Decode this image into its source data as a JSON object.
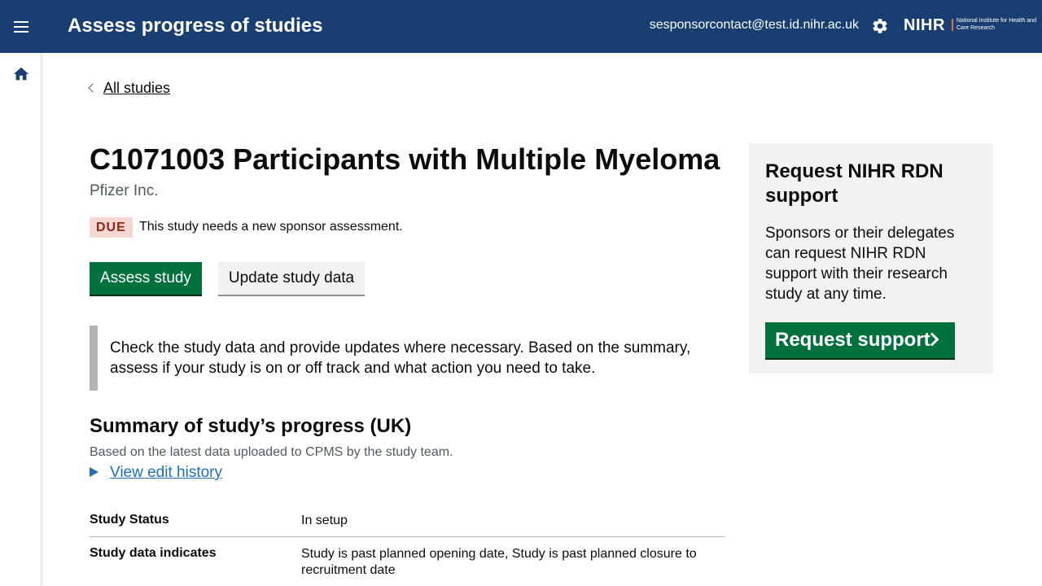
{
  "header": {
    "title": "Assess progress of studies",
    "user_email": "sesponsorcontact@test.id.nihr.ac.uk",
    "logo_main": "NIHR",
    "logo_sub": "National Institute for Health and Care Research",
    "background_color": "#193e72"
  },
  "icons": {
    "menu": "menu-icon",
    "settings": "gear-icon",
    "home": "home-icon",
    "back": "chevron-left-icon",
    "expand": "triangle-right-icon",
    "request": "chevron-right-icon"
  },
  "breadcrumb": {
    "back_label": "All studies"
  },
  "study": {
    "title": "C1071003 Participants with Multiple Myeloma",
    "sponsor": "Pfizer Inc.",
    "tag": "DUE",
    "tag_text": "This study needs a new sponsor assessment."
  },
  "actions": {
    "assess_label": "Assess study",
    "update_label": "Update study data"
  },
  "inset_text": "Check the study data and provide updates where necessary. Based on the summary, assess if your study is on or off track and what action you need to take.",
  "summary": {
    "heading": "Summary of study’s progress (UK)",
    "subtext": "Based on the latest data uploaded to CPMS by the study team.",
    "history_link": "View edit history",
    "rows": [
      {
        "key": "Study Status",
        "value": "In setup"
      },
      {
        "key": "Study data indicates",
        "value": "Study is past planned opening date, Study is past planned closure to recruitment date"
      }
    ]
  },
  "side_panel": {
    "heading": "Request NIHR RDN support",
    "body": "Sponsors or their delegates can request NIHR RDN support with their research study at any time.",
    "button_label": "Request support"
  },
  "colors": {
    "primary_button": "#00703c",
    "link": "#1d70b8",
    "tag_background": "#f6d7d2",
    "tag_text": "#942514",
    "panel_background": "#f3f2f1"
  }
}
